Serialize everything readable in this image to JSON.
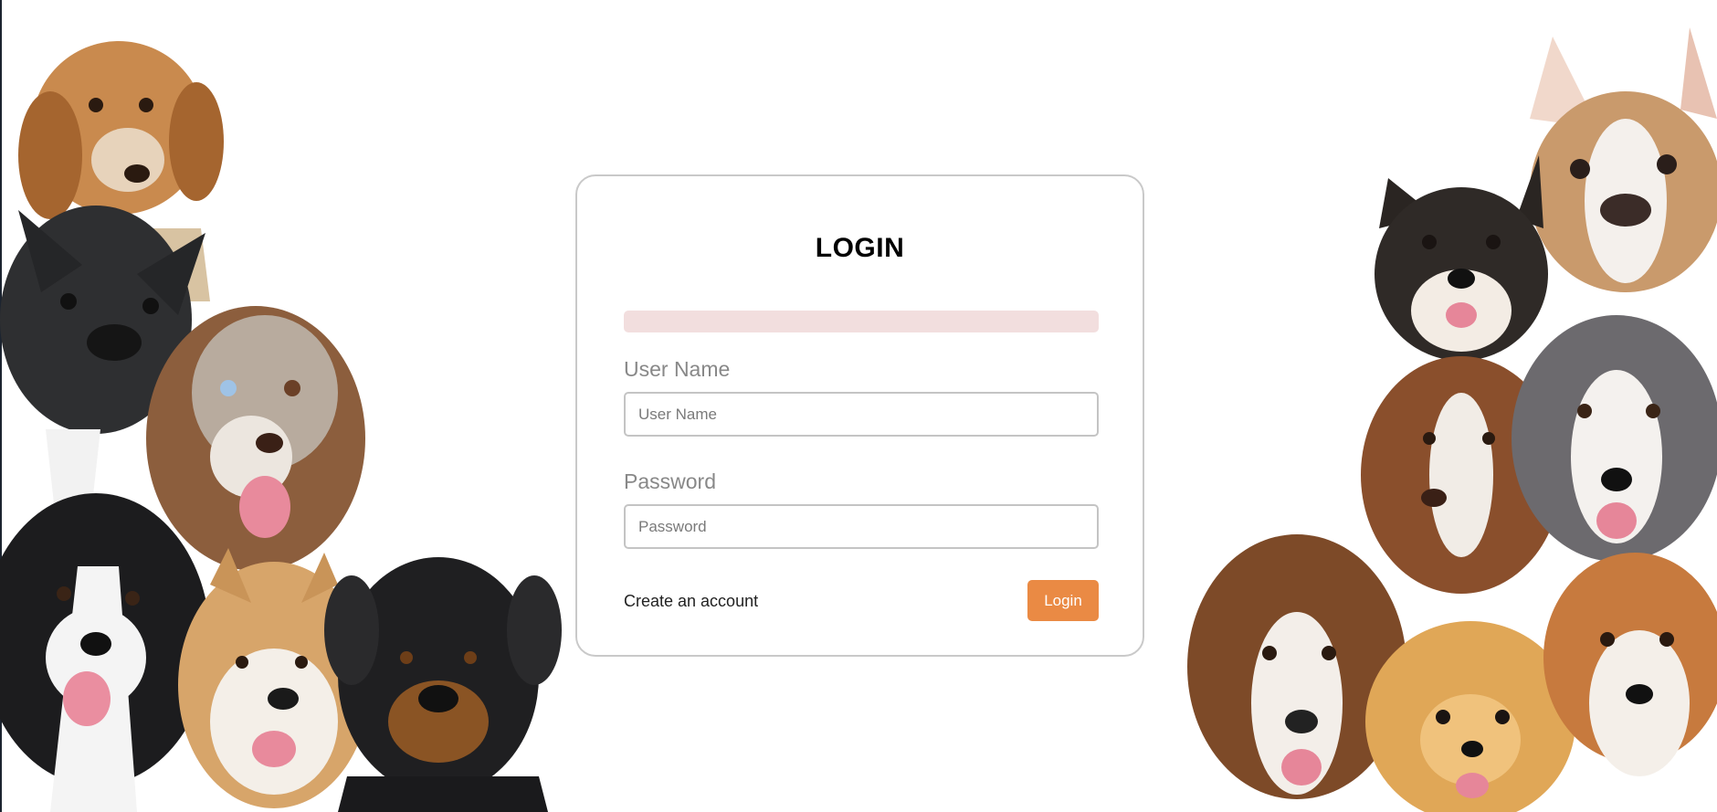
{
  "login_card": {
    "title": "LOGIN",
    "username": {
      "label": "User Name",
      "placeholder": "User Name",
      "value": ""
    },
    "password": {
      "label": "Password",
      "placeholder": "Password",
      "value": ""
    },
    "create_account_label": "Create an account",
    "login_button_label": "Login"
  },
  "colors": {
    "accent": "#ea8a44",
    "alert_background": "#f2dede",
    "card_border": "#c9c9c9",
    "label_text": "#888888"
  },
  "images": {
    "left": "dogs-group-left",
    "right": "dogs-group-right"
  }
}
